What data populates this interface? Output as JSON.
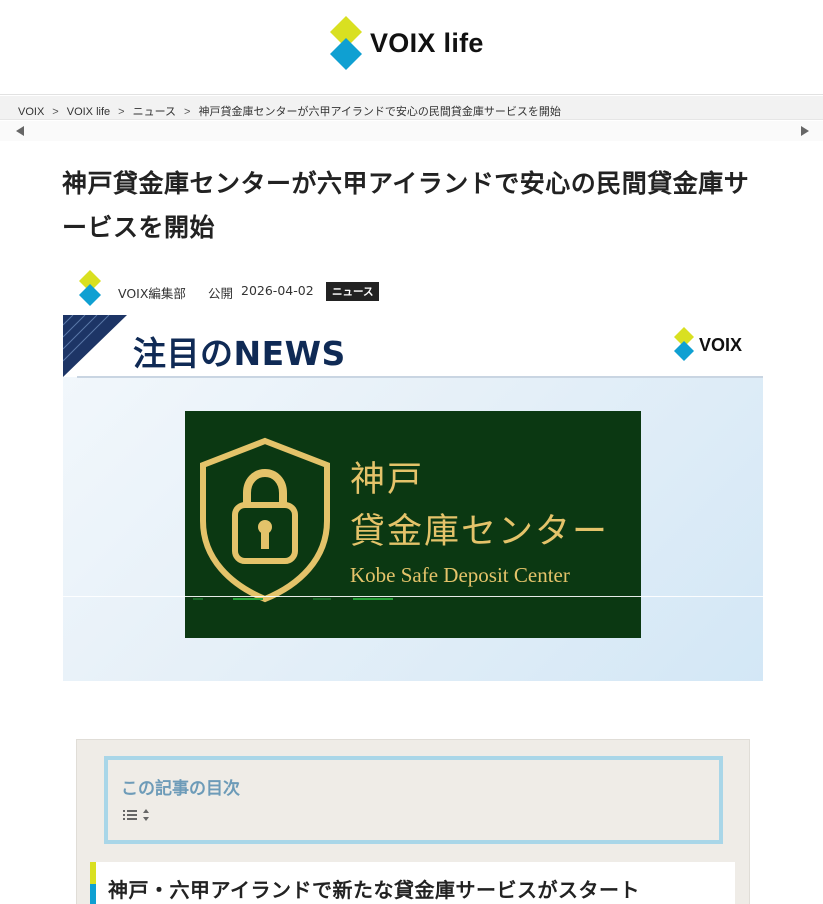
{
  "header": {
    "logo_text": "VOIX life",
    "brand_colors": {
      "yellow": "#d9e021",
      "blue": "#0fa0d2"
    }
  },
  "breadcrumb": {
    "items": [
      "VOIX",
      "VOIX life",
      "ニュース",
      "神戸貸金庫センターが六甲アイランドで安心の民間貸金庫サービスを開始"
    ],
    "separator": ">"
  },
  "article": {
    "title": "神戸貸金庫センターが六甲アイランドで安心の民間貸金庫サービスを開始",
    "author": "VOIX編集部",
    "published_label": "公開",
    "published_date": "2026-04-02",
    "category": "ニュース"
  },
  "hero": {
    "banner_title": "注目のNEWS",
    "banner_logo": "VOIX",
    "panel_line1": "神戸",
    "panel_line2": "貸金庫センター",
    "panel_english": "Kobe Safe Deposit Center",
    "panel_icon": "shield-lock-icon",
    "panel_color": "#0b3812",
    "gold_color": "#e4c36a"
  },
  "toc": {
    "title": "この記事の目次",
    "toggle_icon": "list-toggle-icon",
    "accent_color": "#a9d6e8"
  },
  "section": {
    "heading": "神戸・六甲アイランドで新たな貸金庫サービスがスタート"
  }
}
